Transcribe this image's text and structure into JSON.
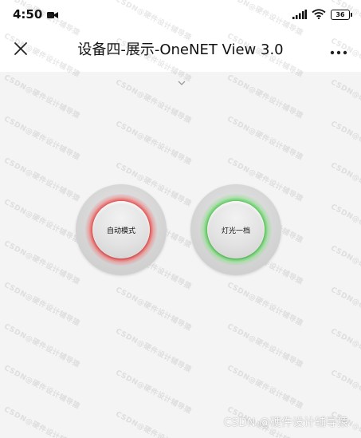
{
  "status_bar": {
    "time": "4:50",
    "battery": "36",
    "icons": [
      "camera-icon",
      "signal-icon",
      "wifi-icon",
      "battery-icon"
    ]
  },
  "title_bar": {
    "title": "设备四-展示-OneNET View 3.0",
    "close_icon": "close-icon",
    "more_icon": "more-horizontal-icon"
  },
  "canvas": {
    "collapse_icon": "chevron-down-icon",
    "buttons": [
      {
        "label": "自动模式",
        "ring_color": "#e64646"
      },
      {
        "label": "灯光一档",
        "ring_color": "#50c850"
      }
    ]
  },
  "watermark": {
    "tile_text": "CSDN@硬件设计辅导猿",
    "footer_text": "CSDN @硬件设计辅导猿"
  }
}
